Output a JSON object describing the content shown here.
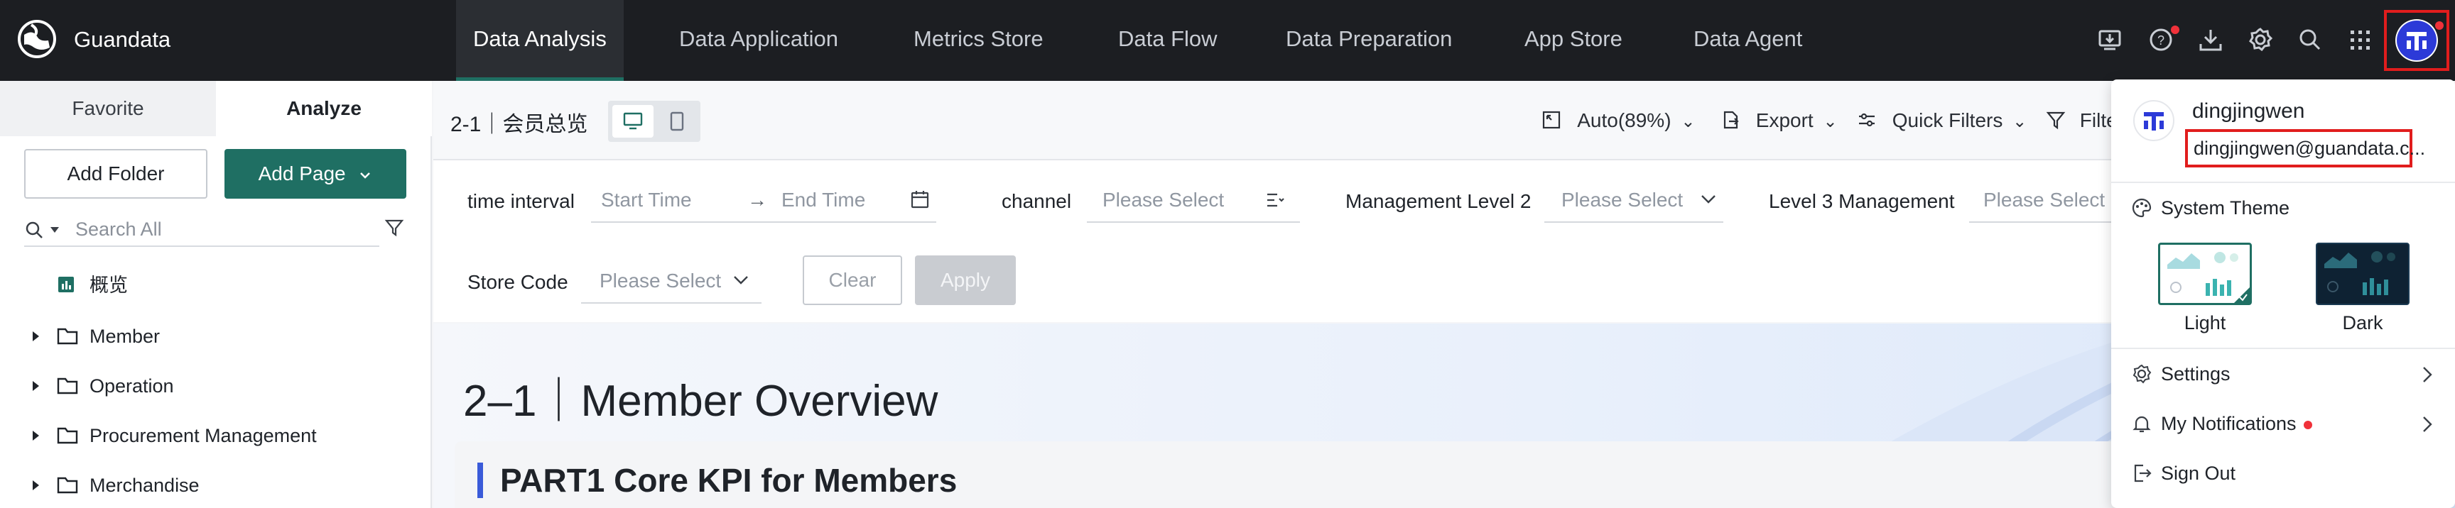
{
  "app": {
    "brand": "Guandata"
  },
  "nav": {
    "tabs": [
      {
        "label": "Data Analysis",
        "active": true
      },
      {
        "label": "Data Application"
      },
      {
        "label": "Metrics Store"
      },
      {
        "label": "Data Flow"
      },
      {
        "label": "Data Preparation"
      },
      {
        "label": "App Store"
      },
      {
        "label": "Data Agent"
      }
    ],
    "icons": [
      "dashboard-download-icon",
      "help-icon",
      "download-icon",
      "settings-icon",
      "search-icon",
      "apps-grid-icon",
      "user-avatar"
    ]
  },
  "sidebar": {
    "tabs": [
      "Favorite",
      "Analyze"
    ],
    "active_tab": "Analyze",
    "add_folder": "Add Folder",
    "add_page": "Add Page",
    "search_placeholder": "Search All",
    "tree": [
      {
        "label": "概览",
        "type": "page"
      },
      {
        "label": "Member",
        "type": "folder"
      },
      {
        "label": "Operation",
        "type": "folder"
      },
      {
        "label": "Procurement Management",
        "type": "folder"
      },
      {
        "label": "Merchandise",
        "type": "folder"
      }
    ]
  },
  "toolbar": {
    "page_title": "2-1｜会员总览",
    "zoom": "Auto(89%)",
    "export": "Export",
    "quick_filters": "Quick Filters",
    "filter": "Filte"
  },
  "filters": {
    "time_interval": "time interval",
    "start_placeholder": "Start Time",
    "end_placeholder": "End Time",
    "channel": "channel",
    "channel_placeholder": "Please Select",
    "mgmt2": "Management Level 2",
    "mgmt2_placeholder": "Please Select",
    "mgmt3": "Level 3 Management",
    "mgmt3_placeholder": "Please Select",
    "store_code": "Store Code",
    "store_placeholder": "Please Select",
    "clear": "Clear",
    "apply": "Apply"
  },
  "content": {
    "title": "2–1｜Member Overview",
    "section": "PART1 Core KPI for Members"
  },
  "user_menu": {
    "username": "dingjingwen",
    "email": "dingjingwen@guandata.c...",
    "system_theme": "System Theme",
    "theme_light": "Light",
    "theme_dark": "Dark",
    "settings": "Settings",
    "notifications": "My Notifications",
    "sign_out": "Sign Out"
  },
  "colors": {
    "accent": "#1f6f63",
    "nav_bg": "#1c1e22",
    "highlight": "#e11d1d",
    "notification_dot": "#f0313a"
  }
}
